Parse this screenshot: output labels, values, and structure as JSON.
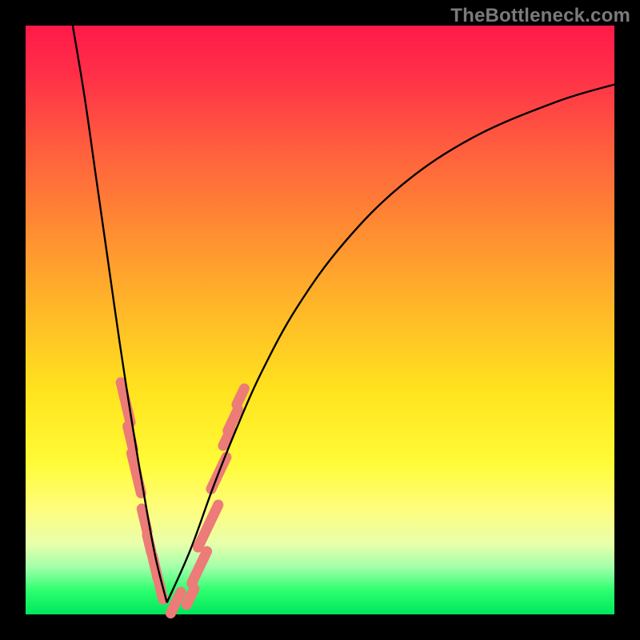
{
  "watermark": "TheBottleneck.com",
  "chart_data": {
    "type": "line",
    "title": "",
    "xlabel": "",
    "ylabel": "",
    "xlim": [
      0,
      100
    ],
    "ylim": [
      0,
      100
    ],
    "notes": "Bottleneck-style V-curve. No axes, ticks, or numeric labels are rendered. Background is a red→yellow→green vertical gradient. Two black curves form a V: left branch descends steeply from top-left to a minimum near x≈24, right branch rises with decreasing slope toward the upper-right. Pink rounded markers cluster near the valley on both branches.",
    "series": [
      {
        "name": "left-branch",
        "x": [
          8,
          10,
          12,
          14,
          16,
          18,
          20,
          22,
          24
        ],
        "y": [
          100,
          88,
          74,
          60,
          46,
          33,
          21,
          10,
          2
        ]
      },
      {
        "name": "right-branch",
        "x": [
          24,
          28,
          32,
          36,
          40,
          46,
          54,
          64,
          76,
          90,
          100
        ],
        "y": [
          2,
          11,
          22,
          32,
          41,
          52,
          63,
          73,
          81,
          87,
          90
        ]
      }
    ],
    "markers": {
      "comment": "Approximate positions of pink rounded markers (same coord system).",
      "points": [
        {
          "x": 17.0,
          "y": 36,
          "len": 7
        },
        {
          "x": 17.8,
          "y": 30,
          "len": 4
        },
        {
          "x": 18.8,
          "y": 24,
          "len": 7
        },
        {
          "x": 20.2,
          "y": 16,
          "len": 4
        },
        {
          "x": 21.0,
          "y": 12,
          "len": 3
        },
        {
          "x": 22.0,
          "y": 8,
          "len": 4
        },
        {
          "x": 23.0,
          "y": 4,
          "len": 3
        },
        {
          "x": 25.5,
          "y": 2,
          "len": 4
        },
        {
          "x": 28.0,
          "y": 3,
          "len": 3
        },
        {
          "x": 29.5,
          "y": 8,
          "len": 6
        },
        {
          "x": 31.0,
          "y": 15,
          "len": 8
        },
        {
          "x": 32.8,
          "y": 24,
          "len": 6
        },
        {
          "x": 34.2,
          "y": 30,
          "len": 3
        },
        {
          "x": 35.2,
          "y": 33,
          "len": 4
        },
        {
          "x": 36.5,
          "y": 37,
          "len": 3
        }
      ],
      "color": "#ed7b77"
    },
    "curve_color": "#000000",
    "curve_width": 2.4
  }
}
